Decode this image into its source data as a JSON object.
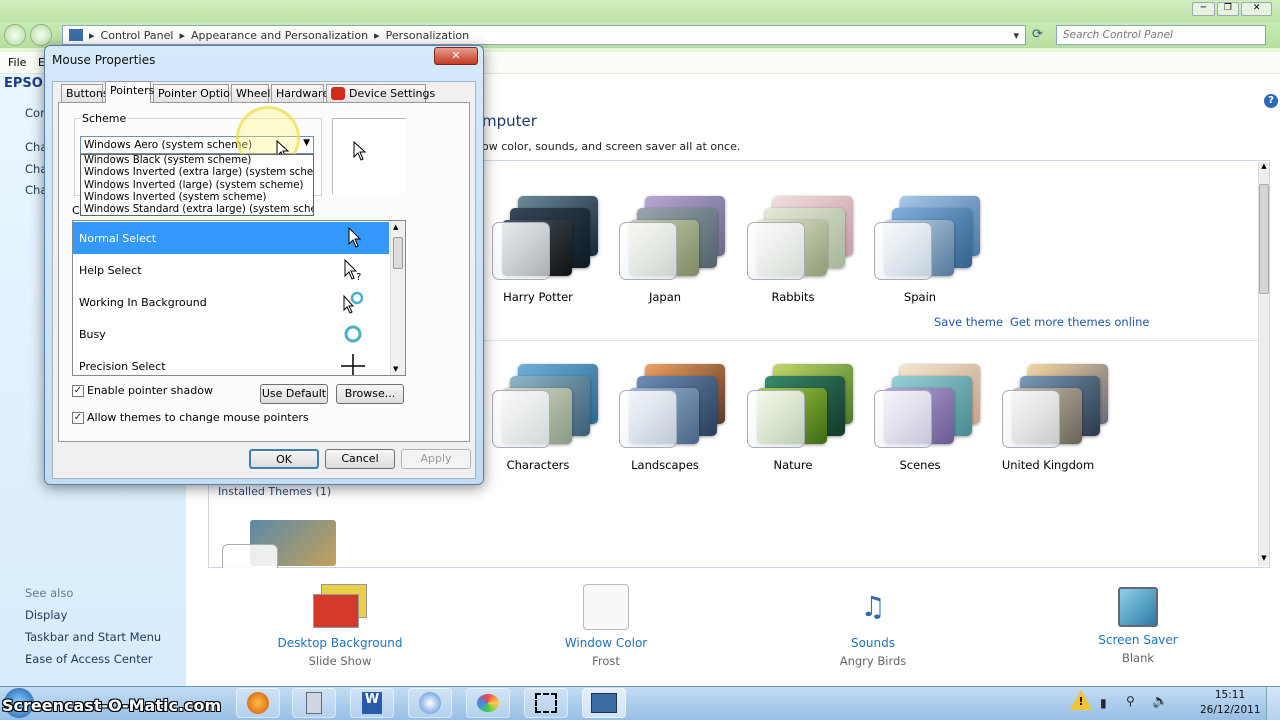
{
  "explorer": {
    "breadcrumb": [
      "Control Panel",
      "Appearance and Personalization",
      "Personalization"
    ],
    "search_placeholder": "Search Control Panel",
    "menu": {
      "file": "File",
      "edit_partial": "E"
    },
    "brand_partial": "EPSON",
    "left_pane": {
      "home_partial": "Cont",
      "links_partial": [
        "Cha",
        "Cha",
        "Cha"
      ],
      "see_also_title": "See also",
      "see_also": [
        "Display",
        "Taskbar and Start Menu",
        "Ease of Access Center"
      ]
    },
    "header_partial": "mputer",
    "subheader_partial": "ow color, sounds, and screen saver all at once.",
    "my_themes": [
      {
        "name": "Harry Potter"
      },
      {
        "name": "Japan"
      },
      {
        "name": "Rabbits"
      },
      {
        "name": "Spain"
      }
    ],
    "save_theme": "Save theme",
    "get_more": "Get more themes online",
    "aero_themes": [
      {
        "name": "Characters"
      },
      {
        "name": "Landscapes"
      },
      {
        "name": "Nature"
      },
      {
        "name": "Scenes"
      },
      {
        "name": "United Kingdom"
      }
    ],
    "installed_themes_label": "Installed Themes (1)",
    "bottom": [
      {
        "title": "Desktop Background",
        "value": "Slide Show",
        "icon": "desktop-background-icon"
      },
      {
        "title": "Window Color",
        "value": "Frost",
        "icon": "window-color-icon"
      },
      {
        "title": "Sounds",
        "value": "Angry Birds",
        "icon": "sounds-icon"
      },
      {
        "title": "Screen Saver",
        "value": "Blank",
        "icon": "screen-saver-icon"
      }
    ],
    "help_icon": "?"
  },
  "dialog": {
    "title": "Mouse Properties",
    "close": "✕",
    "tabs": [
      "Buttons",
      "Pointers",
      "Pointer Options",
      "Wheel",
      "Hardware",
      "Device Settings"
    ],
    "scheme_label": "Scheme",
    "scheme_selected": "Windows Aero (system scheme)",
    "scheme_options": [
      "Windows Black (system scheme)",
      "Windows Inverted (extra large) (system scheme)",
      "Windows Inverted (large) (system scheme)",
      "Windows Inverted (system scheme)",
      "Windows Standard (extra large) (system scheme)"
    ],
    "customize_partial": "Cu",
    "cursors": [
      {
        "name": "Normal Select",
        "icon": "arrow-cursor-icon"
      },
      {
        "name": "Help Select",
        "icon": "help-cursor-icon"
      },
      {
        "name": "Working In Background",
        "icon": "working-cursor-icon"
      },
      {
        "name": "Busy",
        "icon": "busy-cursor-icon"
      },
      {
        "name": "Precision Select",
        "icon": "crosshair-cursor-icon"
      }
    ],
    "enable_shadow": "Enable pointer shadow",
    "allow_themes": "Allow themes to change mouse pointers",
    "use_default": "Use Default",
    "browse": "Browse...",
    "ok": "OK",
    "cancel": "Cancel",
    "apply": "Apply"
  },
  "taskbar": {
    "watermark": "Screencast-O-Matic.com",
    "time": "15:11",
    "date": "26/12/2011"
  }
}
